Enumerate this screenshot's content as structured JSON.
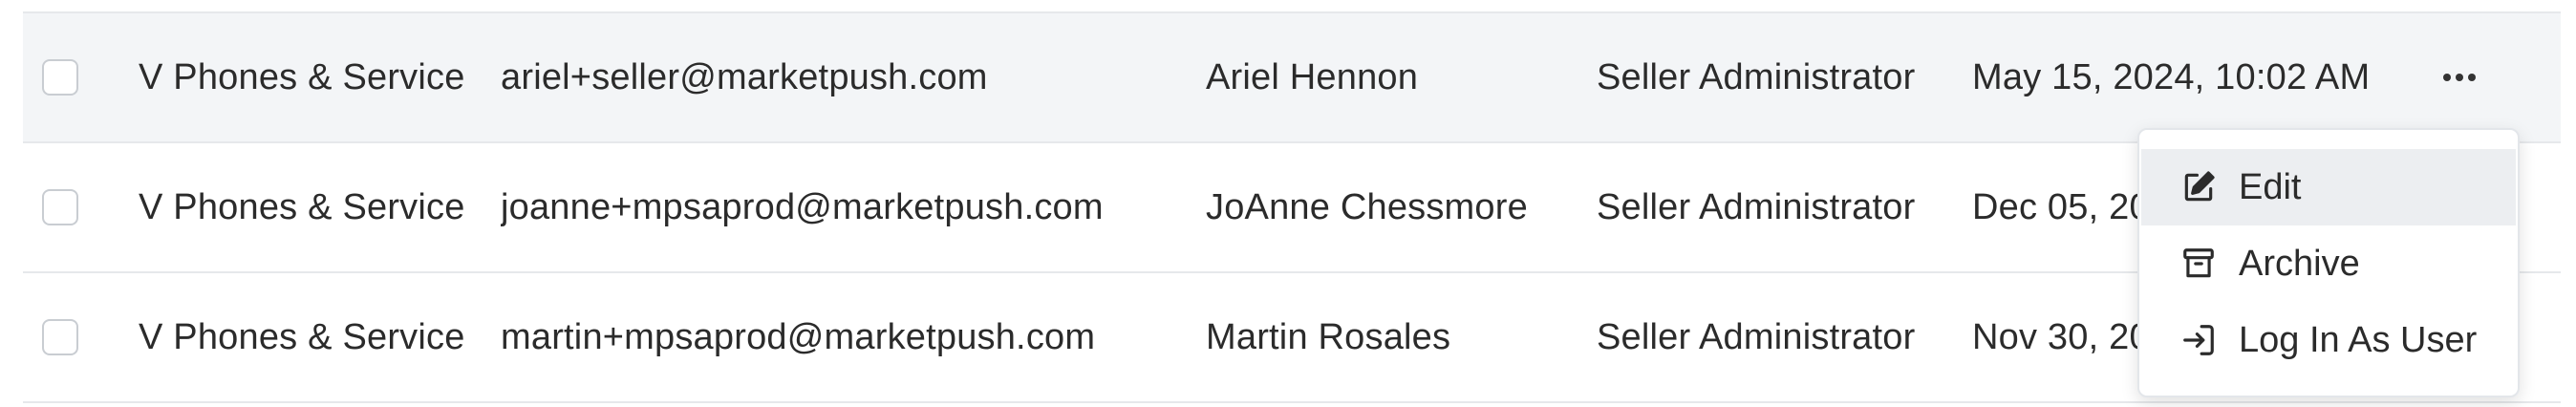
{
  "rows": [
    {
      "store": "V Phones & Service",
      "email": "ariel+seller@marketpush.com",
      "name": "Ariel Hennon",
      "role": "Seller Administrator",
      "date": "May 15, 2024, 10:02 AM"
    },
    {
      "store": "V Phones & Service",
      "email": "joanne+mpsaprod@marketpush.com",
      "name": "JoAnne Chessmore",
      "role": "Seller Administrator",
      "date": "Dec 05, 20"
    },
    {
      "store": "V Phones & Service",
      "email": "martin+mpsaprod@marketpush.com",
      "name": "Martin Rosales",
      "role": "Seller Administrator",
      "date": "Nov 30, 20"
    }
  ],
  "menu": {
    "items": [
      {
        "label": "Edit",
        "icon": "edit-icon"
      },
      {
        "label": "Archive",
        "icon": "archive-icon"
      },
      {
        "label": "Log In As User",
        "icon": "login-icon"
      }
    ]
  },
  "colors": {
    "row_hover": "#f3f5f7",
    "menu_active": "#eceef1",
    "border": "#e6e8eb",
    "text": "#2b2b2b"
  }
}
